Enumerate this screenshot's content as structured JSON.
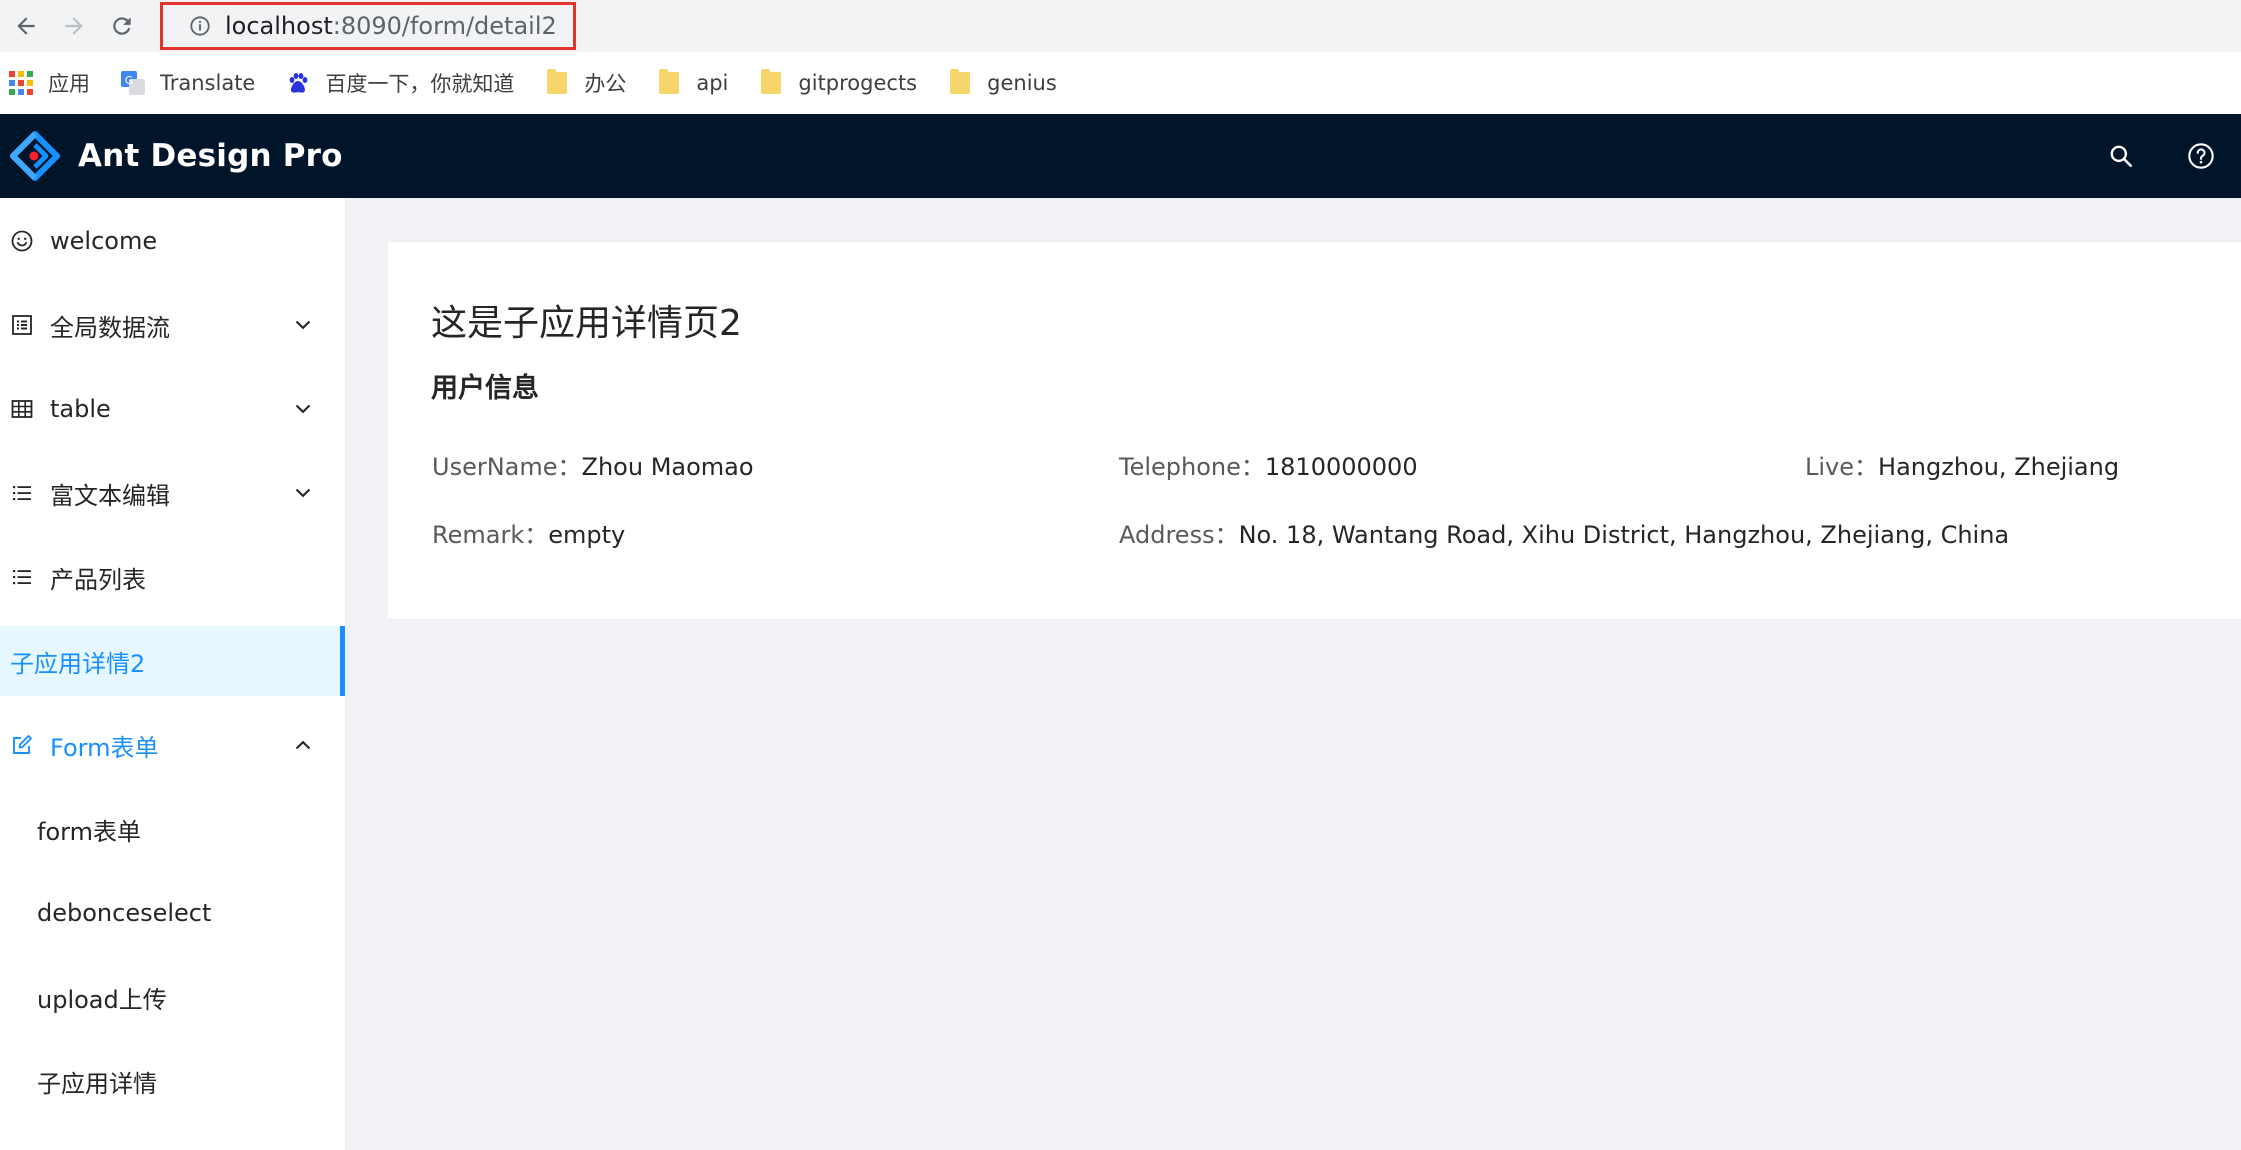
{
  "browser": {
    "url_host": "localhost",
    "url_rest": ":8090/form/detail2"
  },
  "bookmarks": [
    {
      "label": "应用",
      "icon": "apps-grid-icon"
    },
    {
      "label": "Translate",
      "icon": "google-translate-icon"
    },
    {
      "label": "百度一下，你就知道",
      "icon": "baidu-paw-icon"
    },
    {
      "label": "办公",
      "icon": "folder-icon"
    },
    {
      "label": "api",
      "icon": "folder-icon"
    },
    {
      "label": "gitprogects",
      "icon": "folder-icon"
    },
    {
      "label": "genius",
      "icon": "folder-icon"
    }
  ],
  "header": {
    "brand": "Ant Design Pro",
    "bg_color": "#001529"
  },
  "sidebar": {
    "items": [
      {
        "label": "welcome",
        "icon": "smile-icon"
      },
      {
        "label": "全局数据流",
        "icon": "profile-icon",
        "has_children": true
      },
      {
        "label": "table",
        "icon": "table-icon",
        "has_children": true
      },
      {
        "label": "富文本编辑",
        "icon": "list-icon",
        "has_children": true
      },
      {
        "label": "产品列表",
        "icon": "list-icon"
      },
      {
        "label": "子应用详情2",
        "selected": true
      },
      {
        "label": "Form表单",
        "icon": "edit-icon",
        "open": true
      },
      {
        "label": "form表单",
        "sub": true
      },
      {
        "label": "debonceselect",
        "sub": true
      },
      {
        "label": "upload上传",
        "sub": true
      },
      {
        "label": "子应用详情",
        "sub": true
      }
    ],
    "accent_color": "#1890ff"
  },
  "main": {
    "title": "这是子应用详情页2",
    "section_title": "用户信息",
    "fields": [
      {
        "label": "UserName：",
        "value": "Zhou Maomao"
      },
      {
        "label": "Telephone：",
        "value": "1810000000"
      },
      {
        "label": "Live：",
        "value": "Hangzhou, Zhejiang"
      },
      {
        "label": "Remark：",
        "value": "empty"
      },
      {
        "label": "Address：",
        "value": "No. 18, Wantang Road, Xihu District, Hangzhou, Zhejiang, China"
      }
    ]
  }
}
